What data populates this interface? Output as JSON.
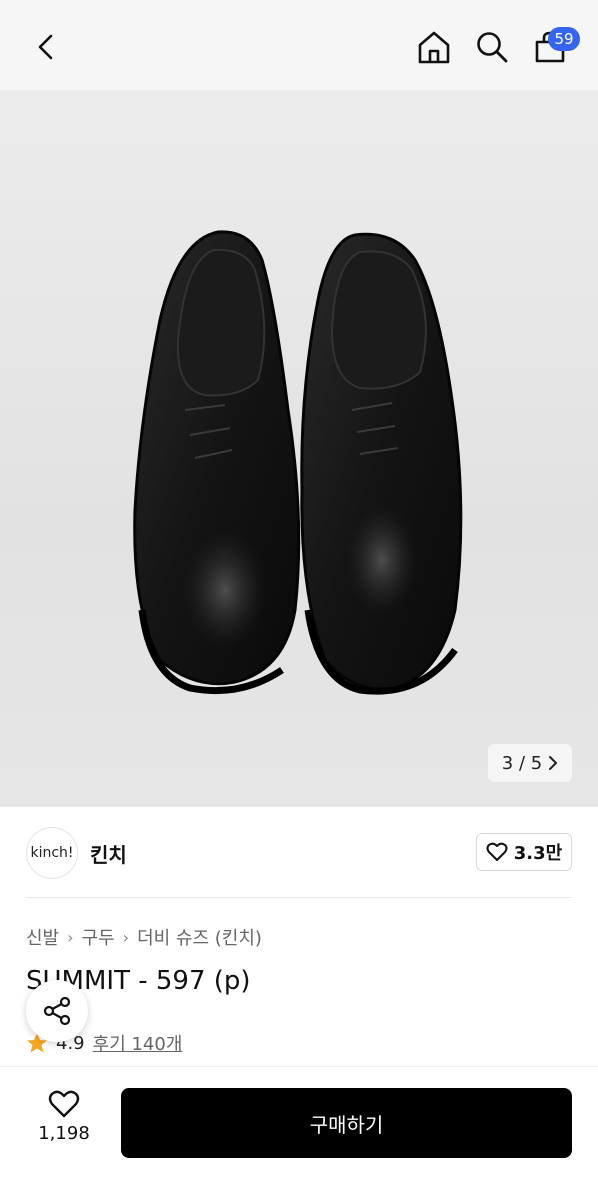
{
  "header": {
    "cart_count": "59",
    "icons": [
      "back-icon",
      "home-icon",
      "search-icon",
      "shopping-bag-icon"
    ]
  },
  "gallery": {
    "counter": "3 / 5",
    "current": 3,
    "total": 5
  },
  "brand": {
    "logo_text": "kinch!",
    "name": "킨치",
    "likes": "3.3만"
  },
  "breadcrumb": [
    "신발",
    "구두",
    "더비 슈즈 (킨치)"
  ],
  "product": {
    "title": "SUMMIT - 597 (p)",
    "rating": "4.9",
    "reviews": "후기 140개"
  },
  "bottom": {
    "wish_count": "1,198",
    "buy_label": "구매하기"
  },
  "colors": {
    "badge": "#3464f0",
    "buy_button": "#000000",
    "star": "#f5a623"
  }
}
